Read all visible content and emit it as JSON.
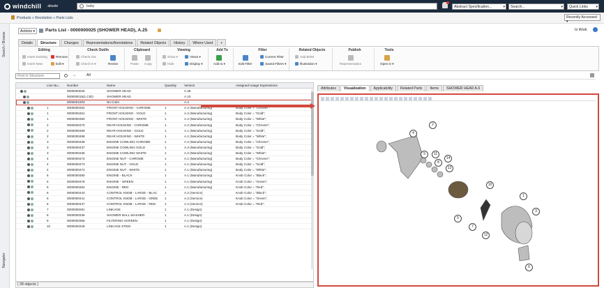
{
  "topbar": {
    "brand": "windchill",
    "user": "abuxte",
    "search_value": "baby",
    "context_select": "Abstract Specification...",
    "search_select": "Search...",
    "quick_links": "Quick Links"
  },
  "breadcrumb": {
    "text": "Products » Revolution » Parts Lists",
    "recent": "Recently Accessed"
  },
  "left_sidebar": {
    "search": "Search / Browse",
    "navigator": "Navigator"
  },
  "header": {
    "actions": "Actions",
    "title": "Parts List - 0000000025 (SHOWER HEAD), A.25",
    "status": "In Work"
  },
  "tabs": [
    "Details",
    "Structure",
    "Changes",
    "Representations/Annotations",
    "Related Objects",
    "History",
    "Where Used",
    "+"
  ],
  "ribbon": {
    "groups": [
      {
        "title": "Editing",
        "items": [
          "Insert Existing",
          "Insert New",
          "Remove",
          "Edit"
        ]
      },
      {
        "title": "Check Out/In",
        "items": [
          "Check Out",
          "Check In",
          "Revise"
        ]
      },
      {
        "title": "Clipboard",
        "items": [
          "Paste",
          "Copy"
        ]
      },
      {
        "title": "Viewing",
        "items": [
          "Show",
          "Hide",
          "Views",
          "Display"
        ]
      },
      {
        "title": "Add To",
        "items": [
          "Add to"
        ]
      },
      {
        "title": "Filter",
        "items": [
          "Edit Filter",
          "Current Filter",
          "Saved Filters"
        ]
      },
      {
        "title": "Related Objects",
        "items": [
          "Add BOM",
          "Illustration"
        ]
      },
      {
        "title": "Publish",
        "items": [
          "Representation"
        ]
      },
      {
        "title": "Tools",
        "items": [
          "Open in"
        ]
      }
    ]
  },
  "find": {
    "placeholder": "Find in Structure",
    "all": "All"
  },
  "table": {
    "columns": [
      "Line Nu...",
      "Number",
      "Name",
      "Quantity",
      "Version",
      "Assigned Usage Expressions"
    ],
    "rows": [
      [
        "",
        "0000000025",
        "SHOWER HEAD",
        "",
        "A.25",
        ""
      ],
      [
        "",
        "000000015(1.CID)",
        "SHOWER HEAD",
        "",
        "A.10",
        ""
      ],
      [
        "",
        "0000001003",
        "No Color",
        "",
        "A.2",
        ""
      ],
      [
        "1",
        "0000000452",
        "FRONT HOUSING - CHROME",
        "1",
        "A.2 (Manufacturing)",
        "Body Color = \"Chrome\";"
      ],
      [
        "1",
        "0000000451",
        "FRONT HOUSING - GOLD",
        "1",
        "A.2 (Manufacturing)",
        "Body Color = \"Gold\";"
      ],
      [
        "1",
        "0000000450",
        "FRONT HOUSING - WHITE",
        "1",
        "A.2 (Manufacturing)",
        "Body Color = \"White\";"
      ],
      [
        "2",
        "0000000470",
        "REAR HOUSING - CHROME",
        "1",
        "A.2 (Manufacturing)",
        "Body Color = \"Chrome\";"
      ],
      [
        "2",
        "0000000469",
        "REAR HOUSING - GOLD",
        "1",
        "A.1 (Manufacturing)",
        "Body Color = \"Gold\";"
      ],
      [
        "2",
        "0000000468",
        "REAR HOUSING - WHITE",
        "1",
        "A.1 (Manufacturing)",
        "Body Color = \"White\";"
      ],
      [
        "3",
        "0000000438",
        "ENGINE COWLING CHROME",
        "1",
        "A.2 (Manufacturing)",
        "Body Color = \"Chrome\";"
      ],
      [
        "3",
        "0000000437",
        "ENGINE COWLING GOLD",
        "1",
        "A.2 (Manufacturing)",
        "Body Color = \"Gold\";"
      ],
      [
        "3",
        "0000000436",
        "ENGINE COWLING WHITE",
        "1",
        "A.2 (Manufacturing)",
        "Body Color = \"White\";"
      ],
      [
        "4",
        "0000000474",
        "ENGINE NUT - CHROME",
        "1",
        "A.1 (Manufacturing)",
        "Body Color = \"Chrome\";"
      ],
      [
        "4",
        "0000000473",
        "ENGINE NUT - GOLD",
        "1",
        "A.1 (Manufacturing)",
        "Body Color = \"Gold\";"
      ],
      [
        "4",
        "0000000472",
        "ENGINE NUT - WHITE",
        "1",
        "A.1 (Manufacturing)",
        "Body Color = \"White\";"
      ],
      [
        "5",
        "0000000480",
        "ENGINE - BLACK",
        "1",
        "A.1 (Manufacturing)",
        "Knob Color = \"Black\";"
      ],
      [
        "5",
        "0000000478",
        "ENGINE - GREEN",
        "1",
        "A.1 (Manufacturing)",
        "Knob Color = \"Green\";"
      ],
      [
        "5",
        "0000000484",
        "ENGINE - RED",
        "1",
        "A.1 (Manufacturing)",
        "Knob Color = \"Red\";"
      ],
      [
        "6",
        "0000000443",
        "CONTROL KNOB - LARGE - BLAC",
        "1",
        "A.2 (Service)",
        "Knob Color = \"Black\";"
      ],
      [
        "6",
        "0000000441",
        "CONTROL KNOB - LARGE - GREE",
        "1",
        "A.2 (Service)",
        "Knob Color = \"Green\";"
      ],
      [
        "6",
        "0000000447",
        "CONTROL KNOB - LARGE - RED",
        "1",
        "A.2 (Service)",
        "Knob Color = \"Red\";"
      ],
      [
        "7",
        "0000000281",
        "LINKAGE",
        "1",
        "A.1 (Design)",
        ""
      ],
      [
        "8",
        "0000000336",
        "SHOWER BALL WASHER",
        "1",
        "A.1 (Design)",
        ""
      ],
      [
        "9",
        "0000000358",
        "FILTERING SCREEN",
        "1",
        "A.1 (Design)",
        ""
      ],
      [
        "10",
        "0000000349",
        "LINKAGE STEM",
        "1",
        "A.1 (Design)",
        ""
      ]
    ],
    "footer": "( 28 objects )"
  },
  "right_tabs": [
    "Attributes",
    "Visualization",
    "Applicability",
    "Related Parts",
    "Items",
    "SHOWER HEAD A.6"
  ],
  "callouts": [
    "1",
    "2",
    "3",
    "4",
    "5",
    "6",
    "7",
    "8",
    "9",
    "10",
    "11",
    "12",
    "13",
    "14"
  ],
  "colors": {
    "accent": "#d2473c",
    "topbar": "#1b2a3c"
  }
}
